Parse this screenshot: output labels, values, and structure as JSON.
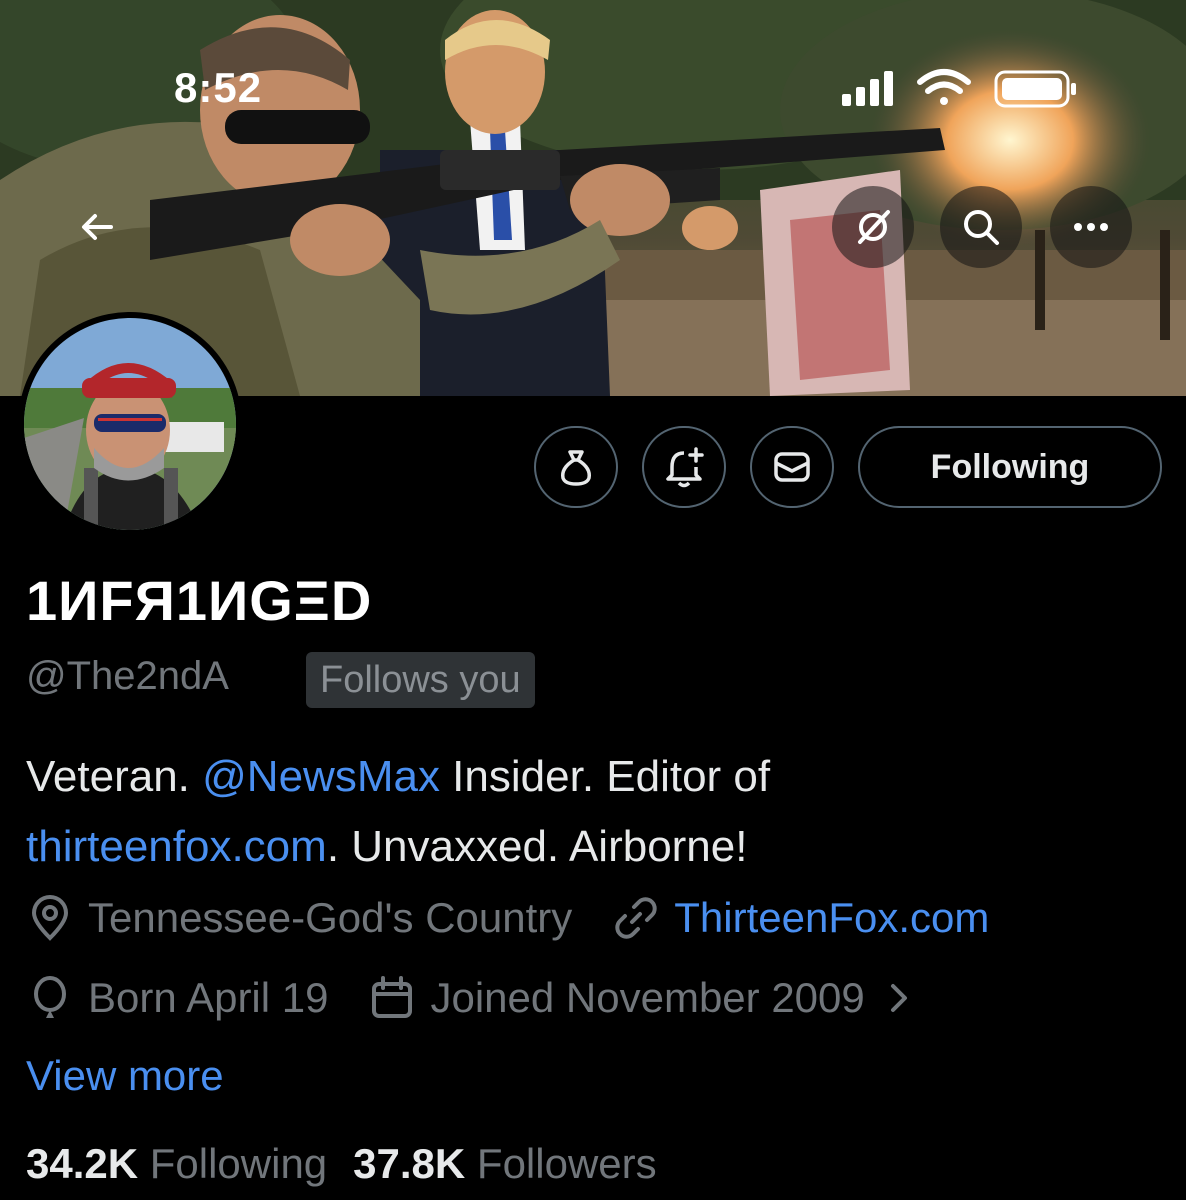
{
  "status_bar": {
    "time": "8:52"
  },
  "profile": {
    "display_name": "1ИFЯ1ИGΞD",
    "handle": "@The2ndA",
    "follows_you": "Follows you",
    "bio": {
      "part1": "Veteran. ",
      "mention": "@NewsMax",
      "part2": " Insider. Editor of ",
      "link": "thirteenfox.com",
      "part3": ". Unvaxxed. Airborne!"
    },
    "location": "Tennessee-God's Country",
    "website": "ThirteenFox.com",
    "birthday": "Born April 19",
    "joined": "Joined November 2009",
    "view_more": "View more",
    "following_count": "34.2K",
    "following_label": "Following",
    "followers_count": "37.8K",
    "followers_label": "Followers"
  },
  "actions": {
    "following_button": "Following"
  },
  "icons": {
    "back": "arrow-left-icon",
    "grok": "grok-icon",
    "search": "search-icon",
    "more": "more-icon",
    "tip": "money-bag-icon",
    "notify": "bell-plus-icon",
    "message": "envelope-icon",
    "location": "location-pin-icon",
    "link": "link-icon",
    "birthday": "balloon-icon",
    "calendar": "calendar-icon"
  },
  "colors": {
    "accent": "#4a8ff0",
    "muted": "#71767b",
    "background": "#000000",
    "text": "#e7e9ea"
  }
}
